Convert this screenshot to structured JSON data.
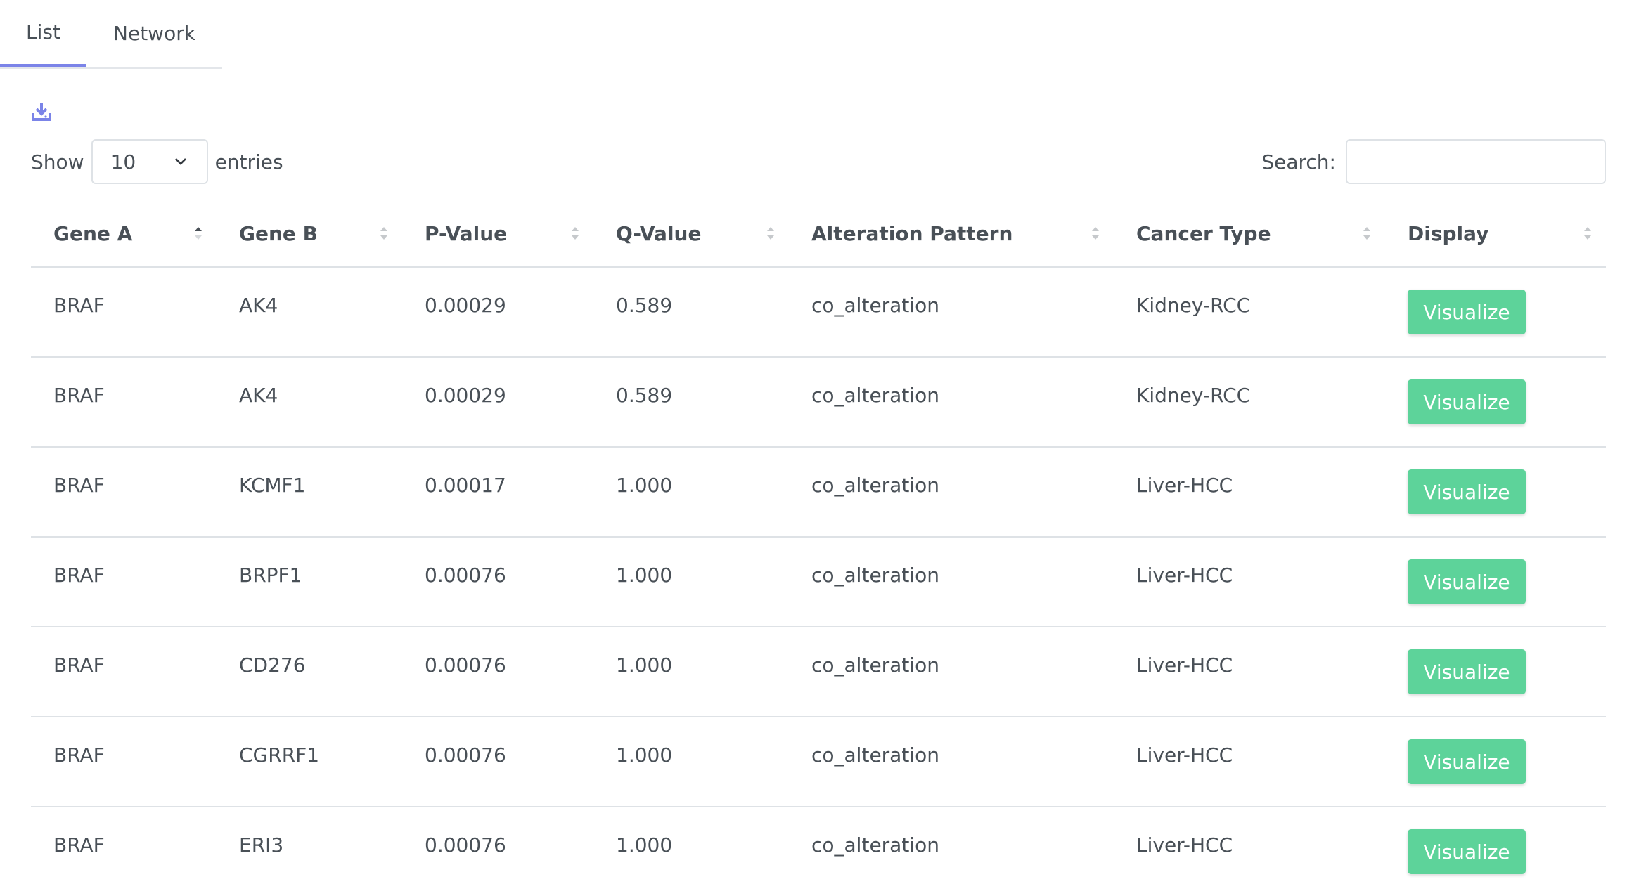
{
  "tabs": [
    {
      "label": "List",
      "active": true
    },
    {
      "label": "Network",
      "active": false
    }
  ],
  "toolbar": {
    "download_icon": "download-icon"
  },
  "length_menu": {
    "prefix": "Show",
    "selected": "10",
    "suffix": "entries"
  },
  "search": {
    "label": "Search:",
    "value": ""
  },
  "colors": {
    "accent": "#7b84e8",
    "button": "#5dd39a",
    "text": "#495057",
    "border": "#dee2e6"
  },
  "table": {
    "headers": [
      "Gene A",
      "Gene B",
      "P-Value",
      "Q-Value",
      "Alteration Pattern",
      "Cancer Type",
      "Display"
    ],
    "rows": [
      {
        "gene_a": "BRAF",
        "gene_b": "AK4",
        "p_value": "0.00029",
        "q_value": "0.589",
        "pattern": "co_alteration",
        "cancer_type": "Kidney-RCC",
        "action": "Visualize"
      },
      {
        "gene_a": "BRAF",
        "gene_b": "AK4",
        "p_value": "0.00029",
        "q_value": "0.589",
        "pattern": "co_alteration",
        "cancer_type": "Kidney-RCC",
        "action": "Visualize"
      },
      {
        "gene_a": "BRAF",
        "gene_b": "KCMF1",
        "p_value": "0.00017",
        "q_value": "1.000",
        "pattern": "co_alteration",
        "cancer_type": "Liver-HCC",
        "action": "Visualize"
      },
      {
        "gene_a": "BRAF",
        "gene_b": "BRPF1",
        "p_value": "0.00076",
        "q_value": "1.000",
        "pattern": "co_alteration",
        "cancer_type": "Liver-HCC",
        "action": "Visualize"
      },
      {
        "gene_a": "BRAF",
        "gene_b": "CD276",
        "p_value": "0.00076",
        "q_value": "1.000",
        "pattern": "co_alteration",
        "cancer_type": "Liver-HCC",
        "action": "Visualize"
      },
      {
        "gene_a": "BRAF",
        "gene_b": "CGRRF1",
        "p_value": "0.00076",
        "q_value": "1.000",
        "pattern": "co_alteration",
        "cancer_type": "Liver-HCC",
        "action": "Visualize"
      },
      {
        "gene_a": "BRAF",
        "gene_b": "ERI3",
        "p_value": "0.00076",
        "q_value": "1.000",
        "pattern": "co_alteration",
        "cancer_type": "Liver-HCC",
        "action": "Visualize"
      }
    ]
  }
}
